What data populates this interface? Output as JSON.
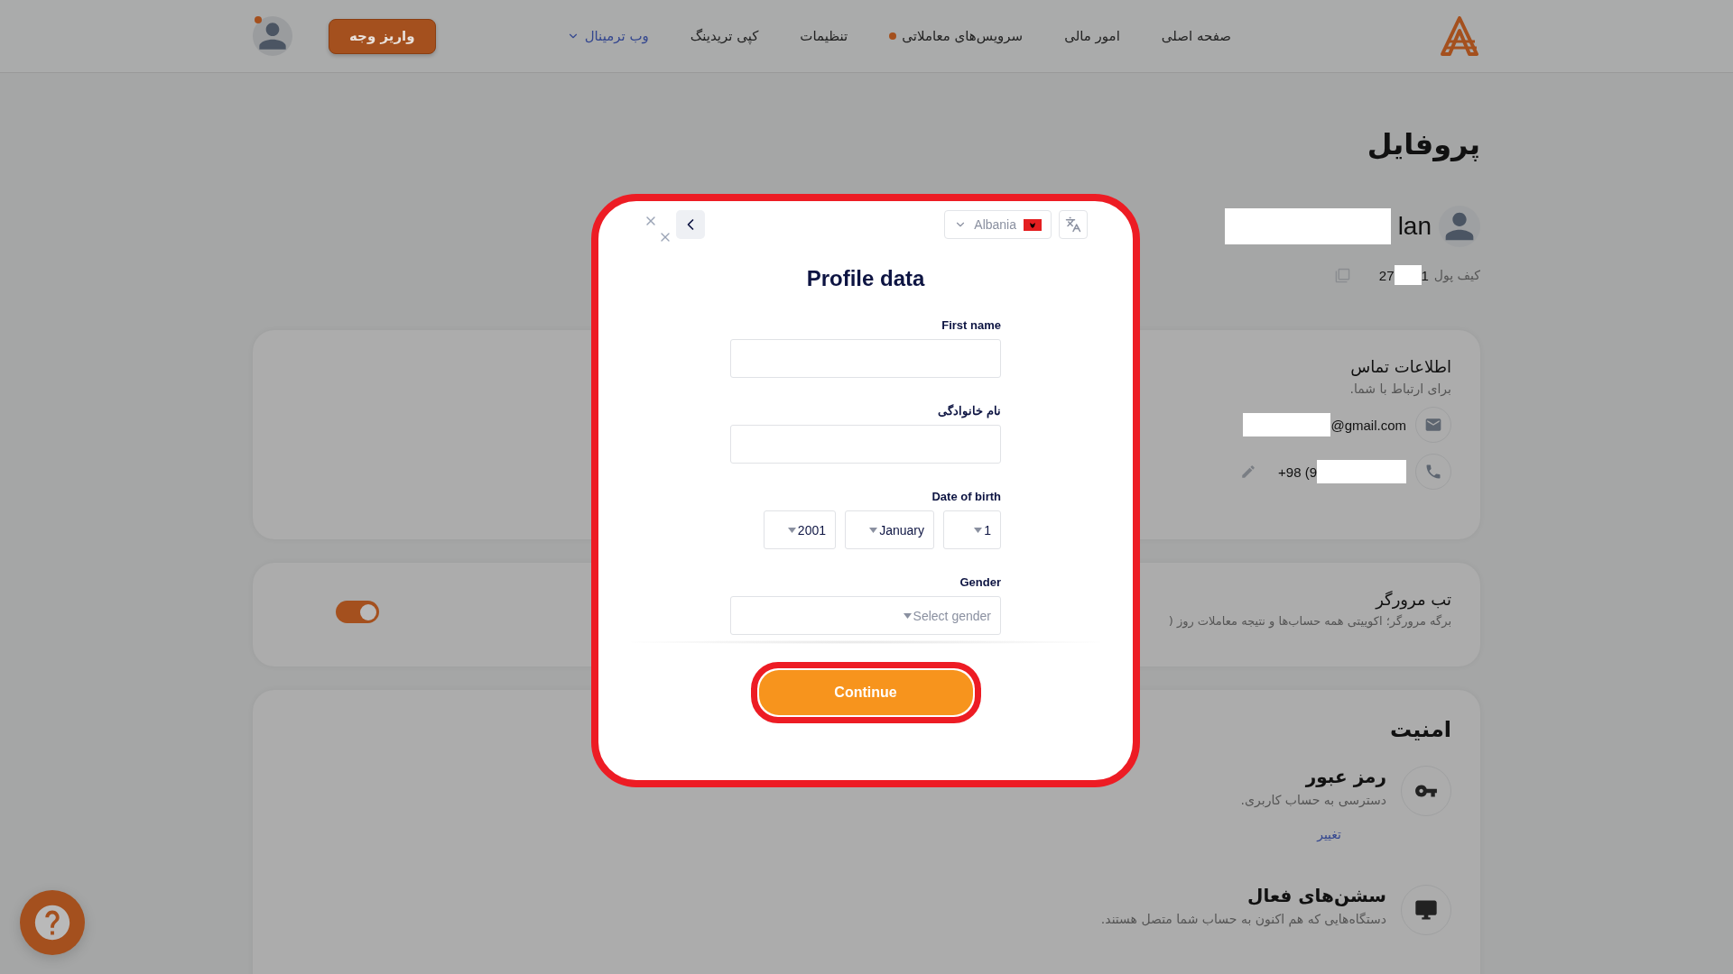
{
  "header": {
    "nav": [
      {
        "label": "صفحه اصلی",
        "kind": "link",
        "dot": false
      },
      {
        "label": "امور مالی",
        "kind": "link",
        "dot": false
      },
      {
        "label": "سرویس‌های معاملاتی",
        "kind": "link",
        "dot": true
      },
      {
        "label": "تنظیمات",
        "kind": "link",
        "dot": false
      },
      {
        "label": "کپی تریدینگ",
        "kind": "link",
        "dot": false
      },
      {
        "label": "وب ترمینال",
        "kind": "dropdown",
        "dot": false
      }
    ],
    "deposit_button": "واریز وجه",
    "avatar_dot": true
  },
  "profile": {
    "title": "پروفایل",
    "name": "lan",
    "wallet_label": "کیف پول",
    "wallet_start": "27",
    "wallet_end": "1"
  },
  "contact": {
    "title": "اطلاعات تماس",
    "subtitle": "برای ارتباط با شما.",
    "items": [
      {
        "kind": "email",
        "value": "@gmail.com"
      },
      {
        "kind": "phone",
        "value": "+98 (9"
      }
    ]
  },
  "browser_tab": {
    "title": "تب مرورگر",
    "description": "برگه مرورگر؛ اکوییتی همه حساب‌ها و نتیجه معاملات روز (",
    "on": true
  },
  "security": {
    "title": "امنیت",
    "items": [
      {
        "kind": "password",
        "title": "رمز عبور",
        "description": "دسترسی به حساب کاربری.",
        "link": "تغییر"
      },
      {
        "kind": "sessions",
        "title": "سشن‌های فعال",
        "description": "دستگاه‌هایی که هم اکنون به حساب شما متصل هستند."
      }
    ]
  },
  "modal": {
    "country": "Albania",
    "title": "Profile data",
    "fields": [
      {
        "kind": "text",
        "label": "First name"
      },
      {
        "kind": "text",
        "label": "نام خانوادگی"
      },
      {
        "kind": "date",
        "label": "Date of birth",
        "parts": [
          "1",
          "January",
          "2001"
        ]
      },
      {
        "kind": "select",
        "label": "Gender",
        "placeholder": "Select gender"
      }
    ],
    "continue_button": "Continue"
  }
}
